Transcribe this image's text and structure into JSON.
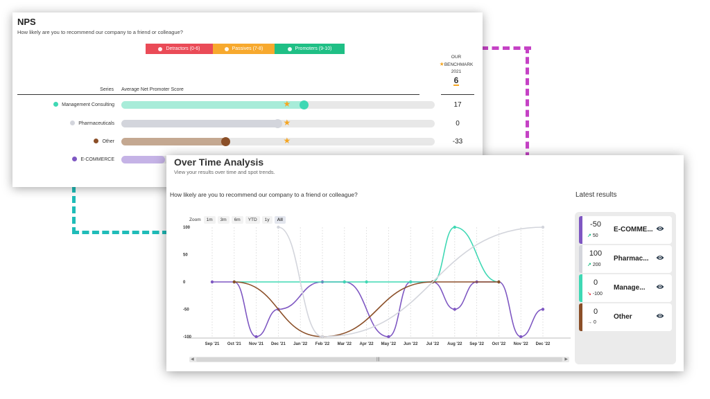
{
  "nps": {
    "title": "NPS",
    "question": "How likely are you to recommend our company to a friend or colleague?",
    "legend": [
      {
        "label": "Detractors (0-6)",
        "color": "#ea4b57"
      },
      {
        "label": "Passives (7-8)",
        "color": "#f7a92e"
      },
      {
        "label": "Promoters (9-10)",
        "color": "#1fbf85"
      }
    ],
    "benchmark": {
      "line1": "OUR",
      "line2": "BENCHMARK",
      "year": "2021",
      "value": "6"
    },
    "columns": {
      "series": "Series",
      "average": "Average Net Promoter Score"
    },
    "rows": [
      {
        "name": "Management Consulting",
        "score": "17",
        "color": "#3fd8b4",
        "track_color": "#a8ecd9",
        "fill": 0.585
      },
      {
        "name": "Pharmaceuticals",
        "score": "0",
        "color": "#d3d5dc",
        "track_color": "#d3d5dc",
        "fill": 0.5
      },
      {
        "name": "Other",
        "score": "-33",
        "color": "#8b4f28",
        "track_color": "#c4a891",
        "fill": 0.335
      },
      {
        "name": "E-COMMERCE",
        "score": "",
        "color": "#7e57c2",
        "track_color": "#c5b3e6",
        "fill": 0.14
      }
    ],
    "benchmark_fill": 0.53
  },
  "over_time": {
    "title": "Over Time Analysis",
    "subtitle": "View your results over time and spot trends.",
    "question": "How likely are you to recommend our company to a friend or colleague?",
    "latest_title": "Latest results",
    "zoom": {
      "label": "Zoom",
      "buttons": [
        "1m",
        "3m",
        "6m",
        "YTD",
        "1y",
        "All"
      ],
      "active": "All"
    },
    "latest": [
      {
        "value": "-50",
        "delta": "50",
        "direction": "up",
        "name": "E-COMME...",
        "color": "#7e57c2",
        "arrow_color": "#1fbf85"
      },
      {
        "value": "100",
        "delta": "200",
        "direction": "up",
        "name": "Pharmac...",
        "color": "#d3d5dc",
        "arrow_color": "#1fbf85"
      },
      {
        "value": "0",
        "delta": "-100",
        "direction": "down",
        "name": "Manage...",
        "color": "#3fd8b4",
        "arrow_color": "#ea4b57"
      },
      {
        "value": "0",
        "delta": "0",
        "direction": "flat",
        "name": "Other",
        "color": "#8b4f28",
        "arrow_color": "#555555"
      }
    ]
  },
  "chart_data": {
    "type": "line",
    "x": [
      "Sep '21",
      "Oct '21",
      "Nov '21",
      "Dec '21",
      "Jan '22",
      "Feb '22",
      "Mar '22",
      "Apr '22",
      "May '22",
      "Jun '22",
      "Jul '22",
      "Aug '22",
      "Sep '22",
      "Oct '22",
      "Nov '22",
      "Dec '22"
    ],
    "ylim": [
      -100,
      100
    ],
    "yticks": [
      100,
      50,
      0,
      -50,
      -100
    ],
    "series": [
      {
        "color": "#7e57c2",
        "values": [
          0,
          0,
          -100,
          -50,
          null,
          0,
          0,
          null,
          -100,
          0,
          0,
          -50,
          0,
          0,
          -100,
          -50
        ]
      },
      {
        "color": "#3fd8b4",
        "values": [
          null,
          0,
          null,
          null,
          null,
          null,
          0,
          0,
          null,
          0,
          0,
          100,
          null,
          0,
          null,
          null
        ]
      },
      {
        "color": "#8b4f28",
        "values": [
          null,
          0,
          null,
          null,
          null,
          -100,
          null,
          null,
          null,
          null,
          0,
          null,
          null,
          0,
          null,
          null
        ]
      },
      {
        "color": "#d3d5dc",
        "values": [
          null,
          null,
          null,
          100,
          null,
          -100,
          null,
          null,
          null,
          null,
          null,
          null,
          null,
          null,
          null,
          100
        ]
      }
    ]
  }
}
